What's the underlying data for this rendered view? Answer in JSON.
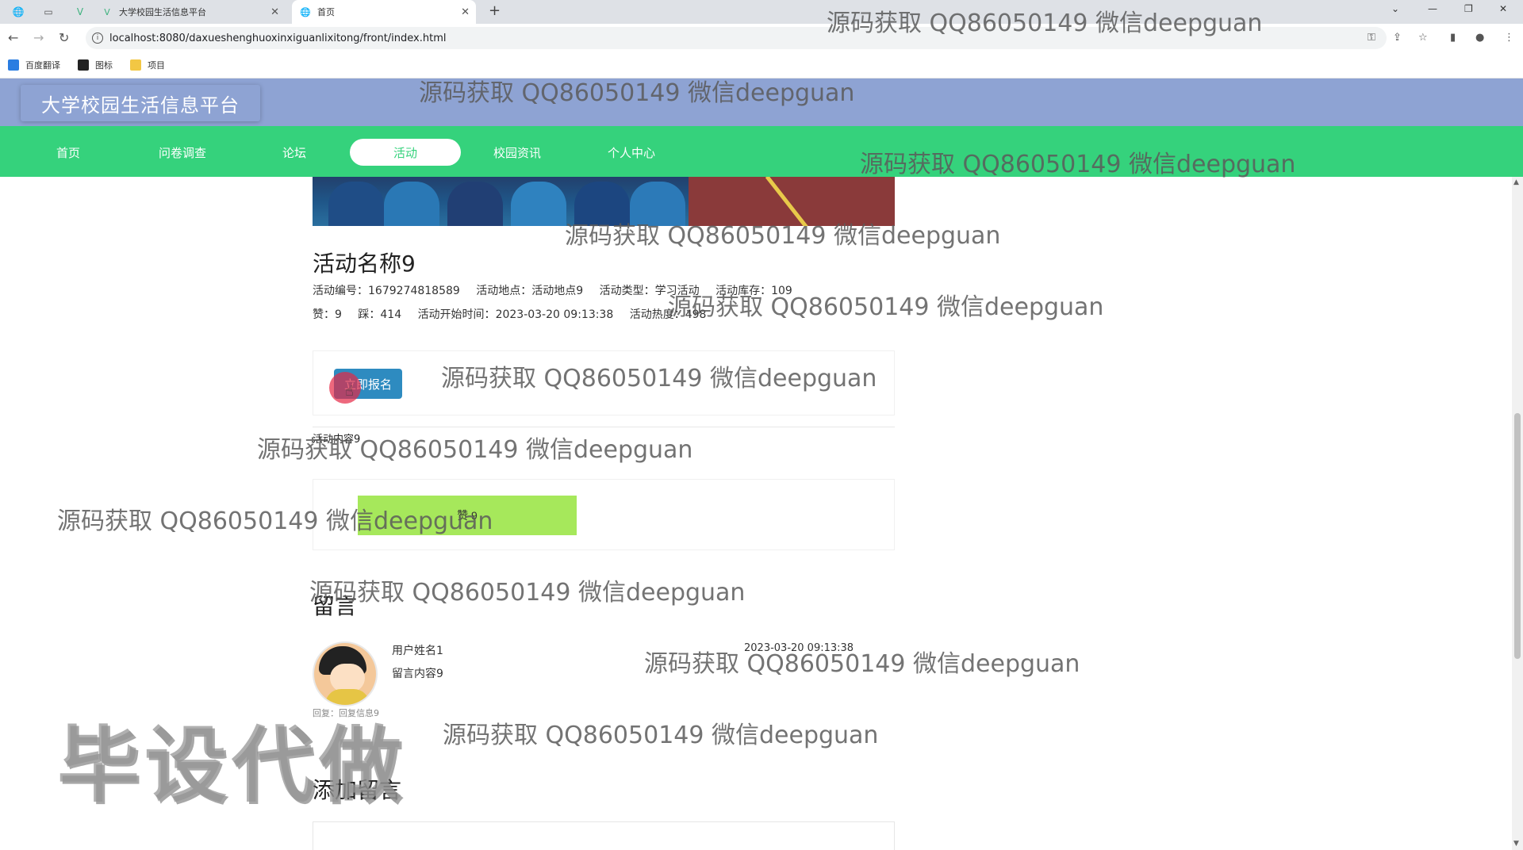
{
  "browser": {
    "tabs": [
      {
        "title": "大学校园生活信息平台"
      },
      {
        "title": "首页"
      }
    ],
    "url": "localhost:8080/daxueshenghuoxinxiguanlixitong/front/index.html",
    "bookmarks": [
      {
        "label": "百度翻译"
      },
      {
        "label": "图标"
      },
      {
        "label": "项目"
      }
    ]
  },
  "site": {
    "logo": "大学校园生活信息平台",
    "nav": [
      {
        "label": "首页"
      },
      {
        "label": "问卷调查"
      },
      {
        "label": "论坛"
      },
      {
        "label": "活动",
        "active": true
      },
      {
        "label": "校园资讯"
      },
      {
        "label": "个人中心"
      }
    ],
    "accent_color": "#35d27c",
    "header_color": "#8ea3d3"
  },
  "activity": {
    "title": "活动名称9",
    "meta_line1": [
      {
        "label": "活动编号：",
        "value": "1679274818589"
      },
      {
        "label": "活动地点：",
        "value": "活动地点9"
      },
      {
        "label": "活动类型：",
        "value": "学习活动"
      },
      {
        "label": "活动库存：",
        "value": "109"
      }
    ],
    "meta_line2": [
      {
        "label": "赞：",
        "value": "9"
      },
      {
        "label": "踩：",
        "value": "414"
      },
      {
        "label": "活动开始时间：",
        "value": "2023-03-20 09:13:38"
      },
      {
        "label": "活动热度：",
        "value": "498"
      }
    ],
    "signup_button": "立即报名",
    "content": "活动内容9",
    "like_button": "赞 9"
  },
  "comments": {
    "section_title": "留言",
    "items": [
      {
        "user": "用户姓名1",
        "content": "留言内容9",
        "time": "2023-03-20 09:13:38",
        "reply": "回复：回复信息9"
      }
    ],
    "add_title": "添加留言"
  },
  "watermarks": {
    "text": "源码获取 QQ86050149 微信deepguan",
    "big": "毕设代做"
  }
}
